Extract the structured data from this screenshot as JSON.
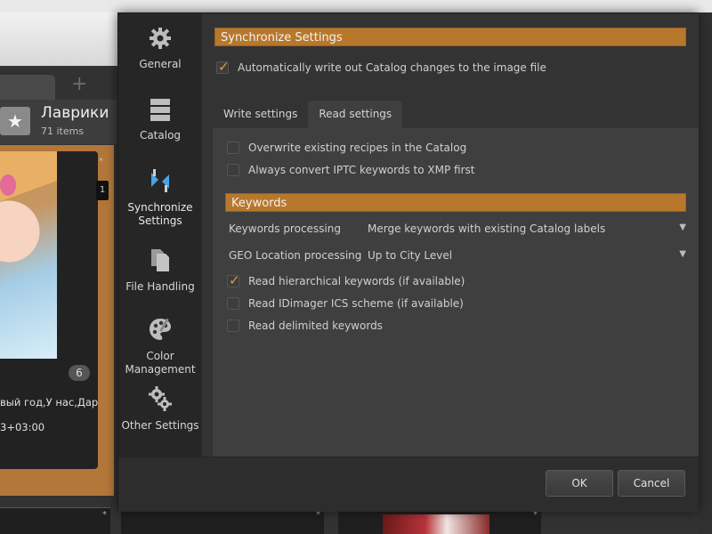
{
  "background": {
    "plus": "+",
    "star": "★",
    "collection_title": "Лаврики",
    "collection_count": "71 items",
    "card_badge_top": "1",
    "card_star": "*",
    "card_badge_count": "6",
    "card_caption": "вый год,У нас,Дари",
    "card_date": "3+03:00",
    "strip_star": "*"
  },
  "nav": {
    "items": [
      {
        "label": "General",
        "icon": "gear-icon"
      },
      {
        "label": "Catalog",
        "icon": "catalog-icon"
      },
      {
        "label": "Synchronize Settings",
        "icon": "sync-icon"
      },
      {
        "label": "File Handling",
        "icon": "files-icon"
      },
      {
        "label": "Color Management",
        "icon": "palette-icon"
      },
      {
        "label": "Other Settings",
        "icon": "gears-icon"
      }
    ]
  },
  "sync": {
    "section_title": "Synchronize Settings",
    "auto_write_label": "Automatically write out Catalog changes to the image file",
    "auto_write_checked": true,
    "tabs": [
      "Write settings",
      "Read settings"
    ],
    "active_tab": "Read settings",
    "overwrite_label": "Overwrite existing recipes in the Catalog",
    "convert_label": "Always convert IPTC keywords to XMP first",
    "keywords_title": "Keywords",
    "keywords_processing_label": "Keywords processing",
    "keywords_processing_value": "Merge keywords with existing Catalog labels",
    "geo_label": "GEO Location processing",
    "geo_value": "Up to City Level",
    "read_hier_label": "Read hierarchical keywords (if available)",
    "read_idimager_label": "Read IDimager ICS scheme (if available)",
    "read_delimited_label": "Read delimited keywords"
  },
  "footer": {
    "ok_label": "OK",
    "cancel_label": "Cancel"
  },
  "colors": {
    "accent": "#b8782c",
    "check": "#e29b3c"
  }
}
